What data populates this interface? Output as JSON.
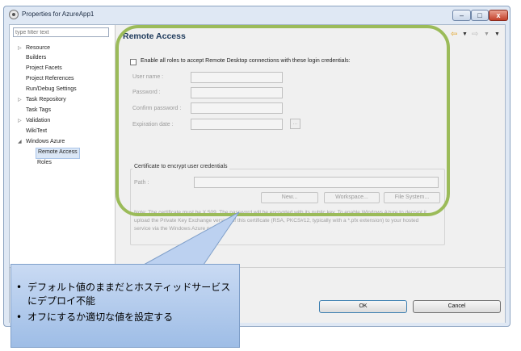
{
  "window": {
    "title": "Properties for AzureApp1",
    "controls": {
      "minimize": "–",
      "maximize": "□",
      "close": "x"
    }
  },
  "tree": {
    "filter_placeholder": "type filter text",
    "items": [
      {
        "label": "Resource",
        "expandable": true
      },
      {
        "label": "Builders",
        "expandable": false
      },
      {
        "label": "Project Facets",
        "expandable": false
      },
      {
        "label": "Project References",
        "expandable": false
      },
      {
        "label": "Run/Debug Settings",
        "expandable": false
      },
      {
        "label": "Task Repository",
        "expandable": true
      },
      {
        "label": "Task Tags",
        "expandable": false
      },
      {
        "label": "Validation",
        "expandable": true
      },
      {
        "label": "WikiText",
        "expandable": false
      },
      {
        "label": "Windows Azure",
        "expanded": true
      },
      {
        "label": "Remote Access",
        "selected": true
      },
      {
        "label": "Roles"
      }
    ]
  },
  "page": {
    "title": "Remote Access",
    "nav_icons": [
      "back-arrow-icon",
      "dropdown-icon",
      "forward-arrow-icon",
      "dropdown-icon",
      "view-menu-icon"
    ],
    "enable_checkbox_label": "Enable all roles to accept Remote Desktop connections with these login credentials:",
    "fields": {
      "user_name": "User name :",
      "password": "Password :",
      "confirm_password": "Confirm password :",
      "expiration_date": "Expiration date :"
    },
    "browse_small": "...",
    "cert_group": {
      "label": "Certificate to encrypt user credentials",
      "path_label": "Path :",
      "buttons": {
        "new": "New...",
        "workspace": "Workspace...",
        "file_system": "File System..."
      },
      "note": "Note: The certificate must be X.509. The password will be encrypted with its public key. To enable Windows Azure to decrypt it, upload the Private Key Exchange version of this certificate (RSA, PKCS#12, typically with a *.pfx extension) to your hosted service via the Windows Azure portal."
    }
  },
  "dialog_buttons": {
    "ok": "OK",
    "cancel": "Cancel"
  },
  "callout": {
    "bullets": [
      "デフォルト値のままだとホスティッドサービスにデプロイ不能",
      "オフにするか適切な値を設定する"
    ]
  },
  "colors": {
    "highlight_oval": "#9bbb59",
    "callout_fill": "#b7cdee"
  }
}
